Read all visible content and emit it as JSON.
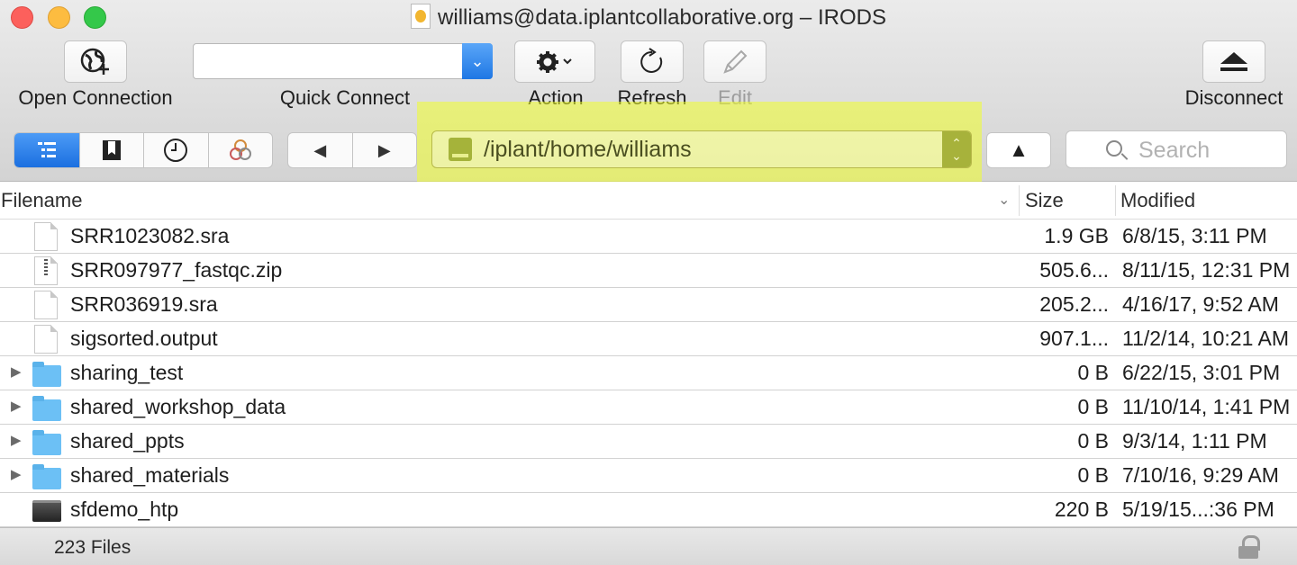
{
  "window": {
    "title": "williams@data.iplantcollaborative.org – IRODS"
  },
  "toolbar": {
    "open_connection": "Open Connection",
    "quick_connect": "Quick Connect",
    "quick_connect_value": "",
    "action": "Action",
    "refresh": "Refresh",
    "edit": "Edit",
    "disconnect": "Disconnect"
  },
  "navigation": {
    "path": "/iplant/home/williams",
    "up_arrow": "▲",
    "back_arrow": "◀",
    "forward_arrow": "▶",
    "search_placeholder": "Search",
    "highlight_color": "#f0ff28"
  },
  "table": {
    "columns": [
      "Filename",
      "Size",
      "Modified"
    ],
    "rows": [
      {
        "name": "SRR1023082.sra",
        "size": "1.9 GB",
        "modified": "6/8/15, 3:11 PM",
        "icon": "document-icon"
      },
      {
        "name": "SRR097977_fastqc.zip",
        "size": "505.6...",
        "modified": "8/11/15, 12:31 PM",
        "icon": "zip-file-icon"
      },
      {
        "name": "SRR036919.sra",
        "size": "205.2...",
        "modified": "4/16/17, 9:52 AM",
        "icon": "document-icon"
      },
      {
        "name": "sigsorted.output",
        "size": "907.1...",
        "modified": "11/2/14, 10:21 AM",
        "icon": "document-icon"
      },
      {
        "name": "sharing_test",
        "size": "0 B",
        "modified": "6/22/15, 3:01 PM",
        "icon": "folder-icon"
      },
      {
        "name": "shared_workshop_data",
        "size": "0 B",
        "modified": "11/10/14, 1:41 PM",
        "icon": "folder-icon"
      },
      {
        "name": "shared_ppts",
        "size": "0 B",
        "modified": "9/3/14, 1:11 PM",
        "icon": "folder-icon"
      },
      {
        "name": "shared_materials",
        "size": "0 B",
        "modified": "7/10/16, 9:29 AM",
        "icon": "folder-icon"
      },
      {
        "name": "sfdemo_htp",
        "size": "220 B",
        "modified": "5/19/15...:36 PM",
        "icon": "executable-icon"
      }
    ]
  },
  "status": {
    "file_count": "223 Files"
  }
}
